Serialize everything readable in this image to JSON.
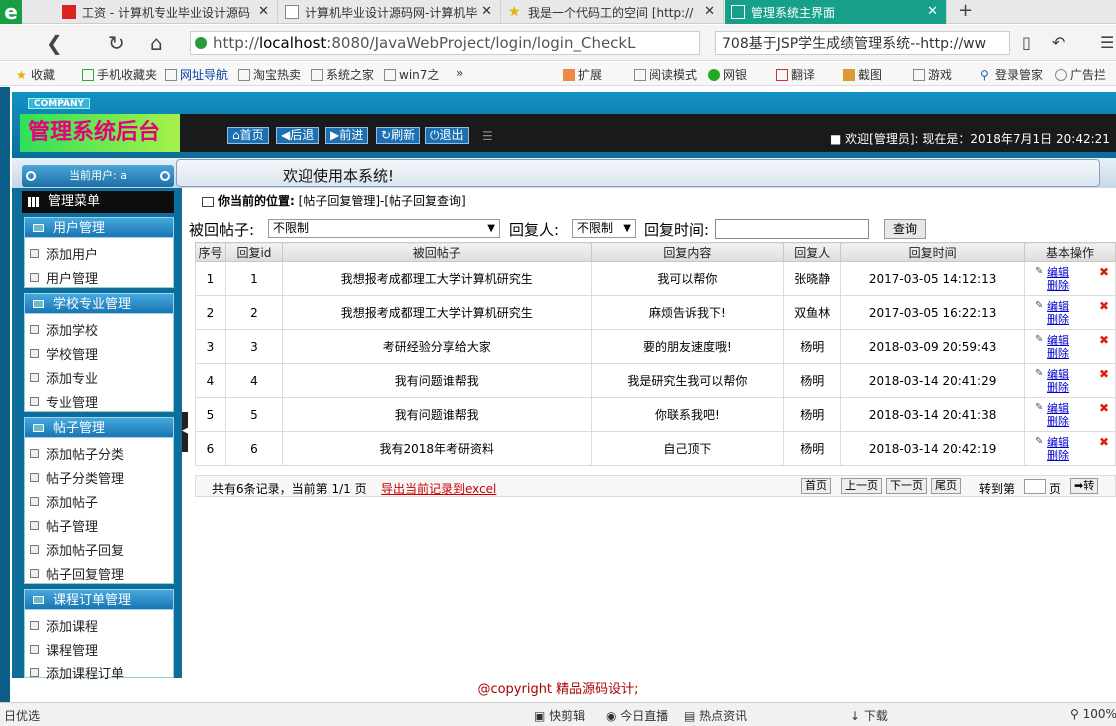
{
  "browser": {
    "tabs": [
      {
        "label": "工资 - 计算机专业毕业设计源码",
        "active": false
      },
      {
        "label": "计算机毕业设计源码网-计算机毕",
        "active": false
      },
      {
        "label": "我是一个代码工的空间 [http://",
        "active": false
      },
      {
        "label": "管理系统主界面",
        "active": true
      }
    ],
    "new_tab": "+",
    "url_prefix": "http://",
    "url_host": "localhost",
    "url_rest": ":8080/JavaWebProject/login/login_CheckL",
    "search_text": "708基于JSP学生成绩管理系统--http://ww",
    "bookmarks": [
      "收藏",
      "手机收藏夹",
      "网址导航",
      "淘宝热卖",
      "系统之家",
      "win7之",
      "»",
      "扩展",
      "阅读模式",
      "网银",
      "翻译",
      "截图",
      "游戏",
      "登录管家",
      "广告拦"
    ]
  },
  "header": {
    "company": "COMPANY",
    "title": "管理系统后台",
    "nav_buttons": [
      "首页",
      "后退",
      "前进",
      "刷新",
      "退出"
    ],
    "welcome": "欢迎[管理员]: 现在是：2018年7月1日 20:42:21"
  },
  "subheader": {
    "current_user": "当前用户: a",
    "welcome_message": "欢迎使用本系统!"
  },
  "sidebar": {
    "menu_title": "管理菜单",
    "groups": [
      {
        "title": "用户管理",
        "items": [
          "添加用户",
          "用户管理"
        ]
      },
      {
        "title": "学校专业管理",
        "items": [
          "添加学校",
          "学校管理",
          "添加专业",
          "专业管理"
        ]
      },
      {
        "title": "帖子管理",
        "items": [
          "添加帖子分类",
          "帖子分类管理",
          "添加帖子",
          "帖子管理",
          "添加帖子回复",
          "帖子回复管理"
        ]
      },
      {
        "title": "课程订单管理",
        "items": [
          "添加课程",
          "课程管理",
          "添加课程订单"
        ]
      }
    ]
  },
  "main": {
    "location_label": "你当前的位置:",
    "location_path": "[帖子回复管理]-[帖子回复查询]",
    "filters": {
      "post_label": "被回帖子:",
      "post_value": "不限制",
      "replier_label": "回复人:",
      "replier_value": "不限制",
      "time_label": "回复时间:",
      "query_button": "查询"
    },
    "table": {
      "headers": [
        "序号",
        "回复id",
        "被回帖子",
        "回复内容",
        "回复人",
        "回复时间",
        "基本操作"
      ],
      "rows": [
        [
          "1",
          "1",
          "我想报考成都理工大学计算机研究生",
          "我可以帮你",
          "张晓静",
          "2017-03-05 14:12:13"
        ],
        [
          "2",
          "2",
          "我想报考成都理工大学计算机研究生",
          "麻烦告诉我下!",
          "双鱼林",
          "2017-03-05 16:22:13"
        ],
        [
          "3",
          "3",
          "考研经验分享给大家",
          "要的朋友速度哦!",
          "杨明",
          "2018-03-09 20:59:43"
        ],
        [
          "4",
          "4",
          "我有问题谁帮我",
          "我是研究生我可以帮你",
          "杨明",
          "2018-03-14 20:41:29"
        ],
        [
          "5",
          "5",
          "我有问题谁帮我",
          "你联系我吧!",
          "杨明",
          "2018-03-14 20:41:38"
        ],
        [
          "6",
          "6",
          "我有2018年考研资料",
          "自己顶下",
          "杨明",
          "2018-03-14 20:42:19"
        ]
      ],
      "edit_label": "编辑",
      "delete_label": "删除"
    },
    "pager": {
      "summary": "共有6条记录，当前第 1/1 页",
      "export": "导出当前记录到excel",
      "first": "首页",
      "prev": "上一页",
      "next": "下一页",
      "last": "尾页",
      "goto_label": "转到第",
      "page_unit": "页",
      "go": "转"
    }
  },
  "footer": "@copyright 精品源码设计;",
  "statusbar": [
    "日优选",
    "快剪辑",
    "今日直播",
    "热点资讯",
    "下载",
    "100%"
  ]
}
